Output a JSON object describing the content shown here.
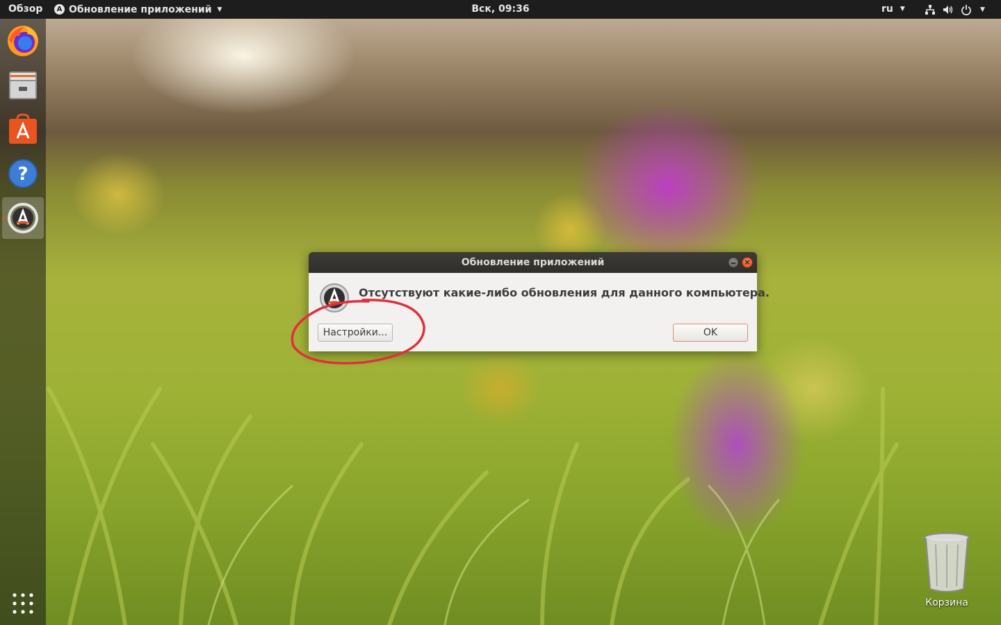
{
  "topbar": {
    "activities_label": "Обзор",
    "app_menu_label": "Обновление приложений",
    "app_menu_icon": "software-updater-icon",
    "clock": "Вск, 09:36",
    "language": "ru",
    "tray_icons": [
      "network-icon",
      "volume-icon",
      "power-icon"
    ]
  },
  "dock": {
    "items": [
      {
        "name": "Firefox",
        "icon": "firefox-icon"
      },
      {
        "name": "Files",
        "icon": "files-icon"
      },
      {
        "name": "Ubuntu Software",
        "icon": "software-center-icon"
      },
      {
        "name": "Help",
        "icon": "help-icon"
      },
      {
        "name": "Software Updater",
        "icon": "software-updater-icon",
        "active": true
      }
    ],
    "show_apps_icon": "apps-grid-icon"
  },
  "desktop": {
    "trash_label": "Корзина"
  },
  "dialog": {
    "title": "Обновление приложений",
    "message": "Отсутствуют какие-либо обновления для данного компьютера.",
    "settings_button": "Настройки...",
    "ok_button": "OK"
  },
  "colors": {
    "accent": "#e95420",
    "annotation": "#e0303a",
    "topbar": "#1d1d1d"
  }
}
